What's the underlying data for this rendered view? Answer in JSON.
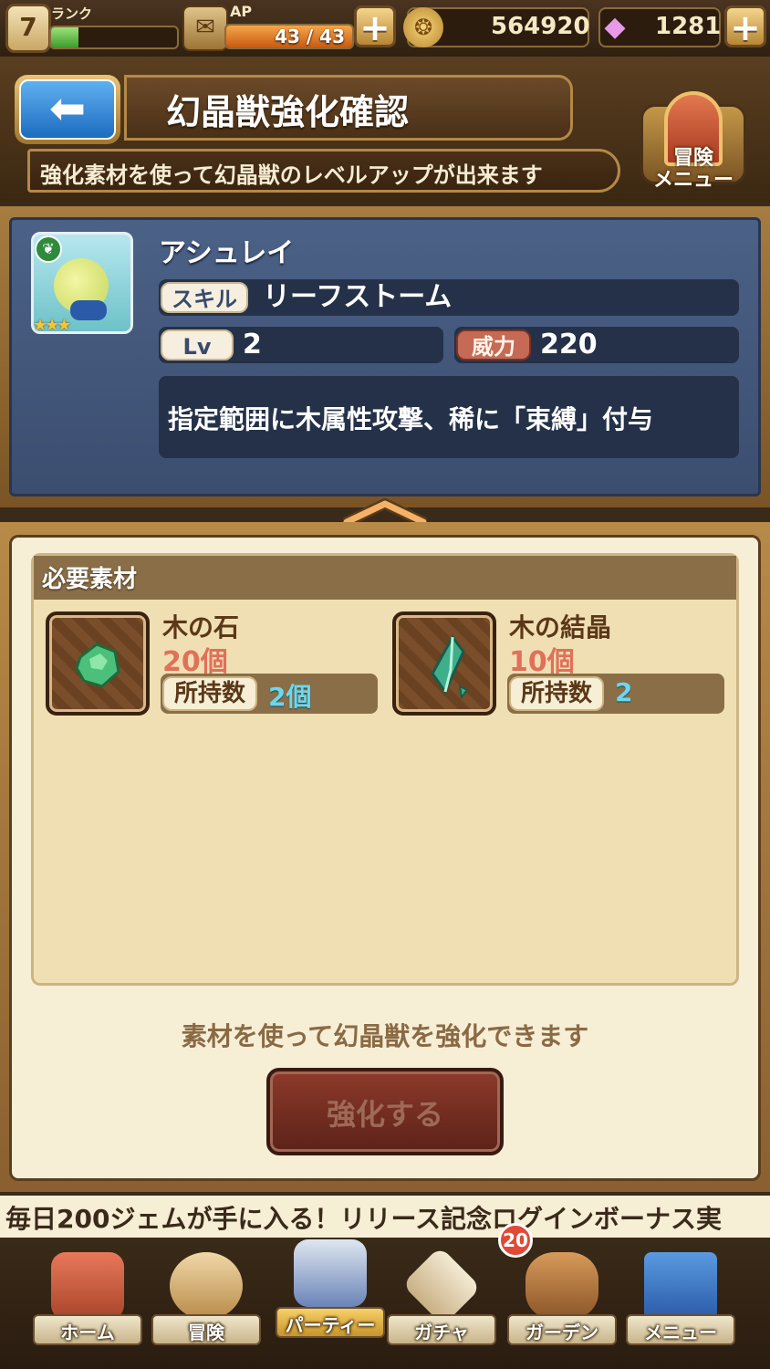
{
  "status": {
    "rank_value": "7",
    "rank_label": "ランク",
    "rank_progress": 0.22,
    "ap_label": "AP",
    "ap_text": "43 / 43",
    "ap_progress": 1.0,
    "gold": "564920",
    "gems": "1281",
    "plus_icon": "plus-icon"
  },
  "header": {
    "title": "幻晶獣強化確認",
    "subtitle": "強化素材を使って幻晶獣のレベルアップが出来ます",
    "adventure_menu_label": "冒険\nメニュー"
  },
  "monster": {
    "name": "アシュレイ",
    "skill_label": "スキル",
    "skill_name": "リーフストーム",
    "lv_label": "Lv",
    "lv_value": "2",
    "power_label": "威力",
    "power_value": "220",
    "description": "指定範囲に木属性攻撃、稀に「束縛」付与",
    "rarity_stars": 3,
    "element_icon": "leaf-icon"
  },
  "materials": {
    "header": "必要素材",
    "items": [
      {
        "name": "木の石",
        "required": "20個",
        "owned_label": "所持数",
        "owned_value": "2個",
        "icon": "green-stone-icon"
      },
      {
        "name": "木の結晶",
        "required": "10個",
        "owned_label": "所持数",
        "owned_value": "2",
        "icon": "green-crystal-icon"
      }
    ]
  },
  "hint": "素材を使って幻晶獣を強化できます",
  "enhance_button": "強化する",
  "ticker": "毎日200ジェムが手に入る！リリース記念ログインボーナス実",
  "nav": [
    {
      "label": "ホーム",
      "icon": "house-icon"
    },
    {
      "label": "冒険",
      "icon": "compass-icon"
    },
    {
      "label": "パーティー",
      "icon": "chess-icon"
    },
    {
      "label": "ガチャ",
      "icon": "dice-icon"
    },
    {
      "label": "ガーデン",
      "icon": "basket-icon",
      "badge": "20"
    },
    {
      "label": "メニュー",
      "icon": "book-icon"
    }
  ],
  "colors": {
    "panel_blue": "#4b6186",
    "accent_red": "#e0705a",
    "owned_cyan": "#6ad8f0"
  }
}
